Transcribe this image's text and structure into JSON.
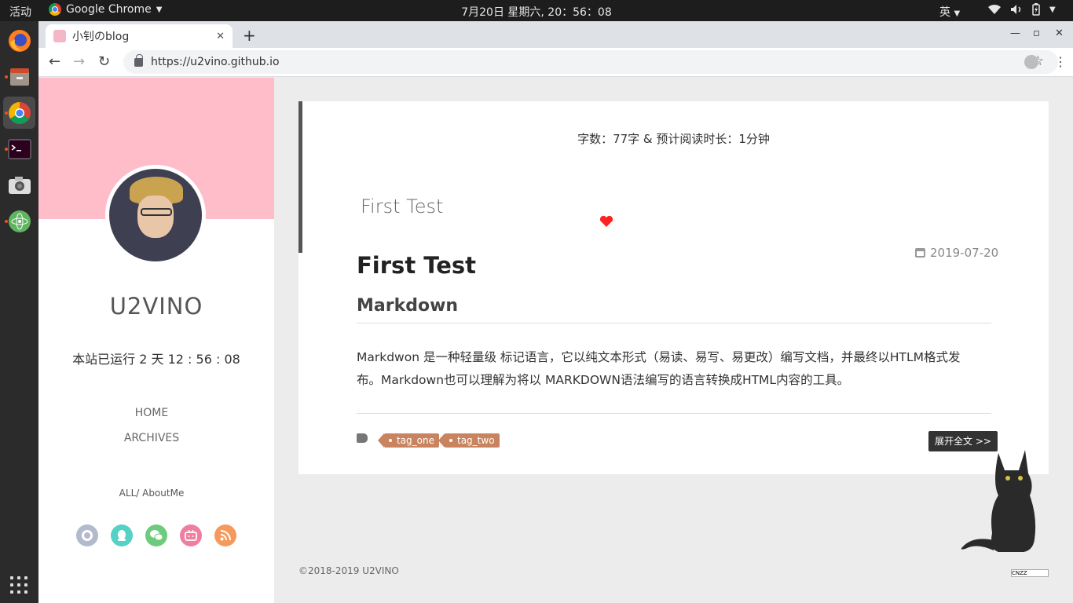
{
  "topbar": {
    "activities": "活动",
    "app_name": "Google Chrome",
    "clock": "7月20日 星期六, 20：56：08",
    "ime": "英"
  },
  "browser": {
    "tab_title": "小钊のblog",
    "url": "https://u2vino.github.io"
  },
  "sidebar": {
    "name": "U2VINO",
    "runtime": "本站已运行 2 天 12 : 56 : 08",
    "menu": [
      "HOME",
      "ARCHIVES"
    ],
    "links": "ALL/ AboutMe",
    "social_icons": [
      "github-icon",
      "qq-icon",
      "wechat-icon",
      "bilibili-icon",
      "rss-icon"
    ],
    "social_colors": [
      "#b4bacd",
      "#56d1c5",
      "#6dcb7d",
      "#f07ea0",
      "#f59a5c"
    ],
    "banner_color": "#ffbdc9"
  },
  "article": {
    "word_count": "字数：77字 & 预计阅读时长：1分钟",
    "subtitle": "First Test",
    "date": "2019-07-20",
    "title": "First Test",
    "heading": "Markdown",
    "body_line1": "Markdwon 是一种轻量级 标记语言，它以纯文本形式（易读、易写、易更改）编写文档，并最终以HTLM格式发",
    "body_line2": "布。Markdown也可以理解为将以 MARKDOWN语法编写的语言转换成HTML内容的工具。",
    "tags": [
      "tag_one",
      "tag_two"
    ],
    "read_more": "展开全文 >>"
  },
  "footer": {
    "copyright": "©2018-2019 U2VINO",
    "cnzz": "CNZZ"
  }
}
